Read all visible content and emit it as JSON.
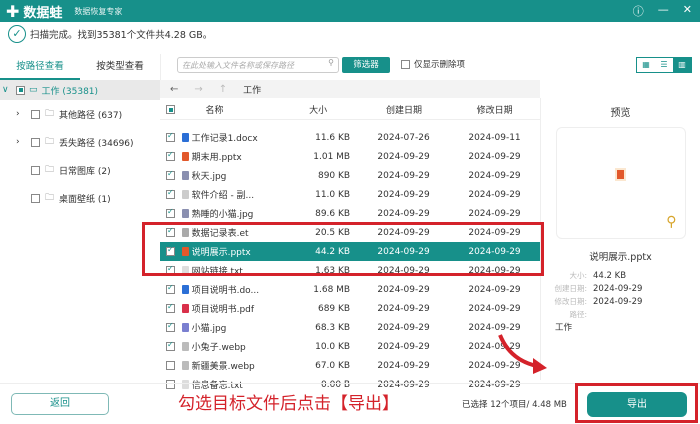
{
  "app": {
    "name": "数据蛙",
    "subtitle": "数据恢复专家",
    "help_icon": "help-icon",
    "minimize_icon": "minimize-icon",
    "close_icon": "close-icon"
  },
  "status": "扫描完成。找到35381个文件共4.28 GB。",
  "tabs": [
    {
      "label": "按路径查看",
      "active": true
    },
    {
      "label": "按类型查看",
      "active": false
    }
  ],
  "toolbar": {
    "search_placeholder": "在此处输入文件名称或保存路径",
    "filter_label": "筛选器",
    "only_deleted_label": "仅显示删除项",
    "views": [
      "grid-view",
      "list-view",
      "detail-view"
    ],
    "active_view": "detail-view"
  },
  "tree": {
    "root": "工作 (35381)",
    "items": [
      "其他路径 (637)",
      "丢失路径 (34696)",
      "日常图库 (2)",
      "桌面壁纸 (1)"
    ]
  },
  "nav": {
    "back": "←",
    "forward": "→",
    "up": "↑",
    "path": "工作"
  },
  "columns": [
    "名称",
    "大小",
    "创建日期",
    "修改日期"
  ],
  "files": [
    {
      "name": "工作记录1.docx",
      "size": "11.6 KB",
      "created": "2024-07-26",
      "modified": "2024-09-11",
      "checked": true,
      "color": "#2b6fd6"
    },
    {
      "name": "期末用.pptx",
      "size": "1.01 MB",
      "created": "2024-09-29",
      "modified": "2024-09-29",
      "checked": true,
      "color": "#e2582b"
    },
    {
      "name": "秋天.jpg",
      "size": "890 KB",
      "created": "2024-09-29",
      "modified": "2024-09-29",
      "checked": true,
      "color": "#8a8fb0"
    },
    {
      "name": "软件介绍 - 副...",
      "size": "11.0 KB",
      "created": "2024-09-29",
      "modified": "2024-09-29",
      "checked": true,
      "color": "#cccccc"
    },
    {
      "name": "熟睡的小猫.jpg",
      "size": "89.6 KB",
      "created": "2024-09-29",
      "modified": "2024-09-29",
      "checked": true,
      "color": "#8a8fb0"
    },
    {
      "name": "数据记录表.et",
      "size": "20.5 KB",
      "created": "2024-09-29",
      "modified": "2024-09-29",
      "checked": true,
      "color": "#aaaaaa"
    },
    {
      "name": "说明展示.pptx",
      "size": "44.2 KB",
      "created": "2024-09-29",
      "modified": "2024-09-29",
      "checked": true,
      "color": "#e2582b",
      "selected": true
    },
    {
      "name": "网站链接.txt",
      "size": "1.63 KB",
      "created": "2024-09-29",
      "modified": "2024-09-29",
      "checked": true,
      "color": "#dddddd"
    },
    {
      "name": "项目说明书.do...",
      "size": "1.68 MB",
      "created": "2024-09-29",
      "modified": "2024-09-29",
      "checked": true,
      "color": "#2b6fd6"
    },
    {
      "name": "项目说明书.pdf",
      "size": "689 KB",
      "created": "2024-09-29",
      "modified": "2024-09-29",
      "checked": true,
      "color": "#d9304a"
    },
    {
      "name": "小猫.jpg",
      "size": "68.3 KB",
      "created": "2024-09-29",
      "modified": "2024-09-29",
      "checked": true,
      "color": "#7a7fd0"
    },
    {
      "name": "小兔子.webp",
      "size": "10.0 KB",
      "created": "2024-09-29",
      "modified": "2024-09-29",
      "checked": true,
      "color": "#bbbbbb"
    },
    {
      "name": "新疆美景.webp",
      "size": "67.0 KB",
      "created": "2024-09-29",
      "modified": "2024-09-29",
      "checked": false,
      "color": "#bbbbbb"
    },
    {
      "name": "信息备忘.txt",
      "size": "0.00 B",
      "created": "2024-09-29",
      "modified": "2024-09-29",
      "checked": false,
      "color": "#dddddd"
    }
  ],
  "preview": {
    "title": "预览",
    "name": "说明展示.pptx",
    "size_label": "大小:",
    "size": "44.2 KB",
    "created_label": "创建日期:",
    "created": "2024-09-29",
    "modified_label": "修改日期:",
    "modified": "2024-09-29",
    "path_label": "路径:",
    "path": "工作"
  },
  "footer": {
    "back_label": "返回",
    "instruction": "勾选目标文件后点击【导出】",
    "selected_info": "已选择 12个项目/ 4.48 MB",
    "export_label": "导出"
  },
  "colors": {
    "accent": "#17908a",
    "annotation": "#d4222a"
  }
}
